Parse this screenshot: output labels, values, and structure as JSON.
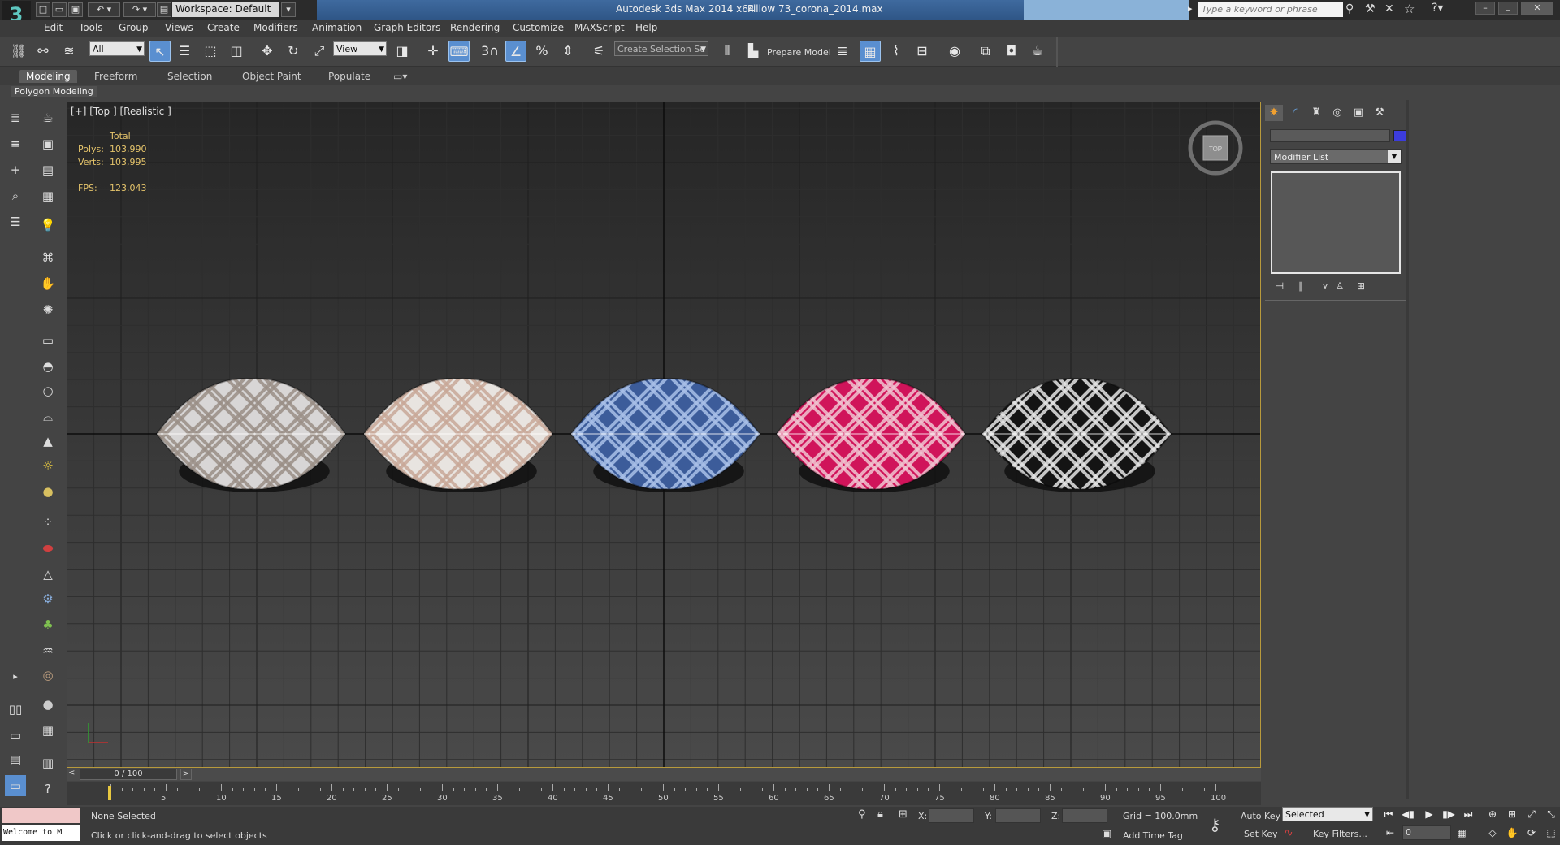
{
  "titlebar": {
    "app_title": "Autodesk 3ds Max  2014 x64",
    "file_name": "Pillow 73_corona_2014.max",
    "workspace_label": "Workspace: Default",
    "search_placeholder": "Type a keyword or phrase"
  },
  "menu": [
    "Edit",
    "Tools",
    "Group",
    "Views",
    "Create",
    "Modifiers",
    "Animation",
    "Graph Editors",
    "Rendering",
    "Customize",
    "MAXScript",
    "Help"
  ],
  "toolbar": {
    "selection_filter": "All",
    "ref_coord": "View",
    "named_selection": "Create Selection Se",
    "prepare_model": "Prepare Model",
    "snap_label": "3",
    "percent_label": "%"
  },
  "ribbon": {
    "tabs": [
      "Modeling",
      "Freeform",
      "Selection",
      "Object Paint",
      "Populate"
    ],
    "panel": "Polygon Modeling"
  },
  "viewport": {
    "label": "[+] [Top ] [Realistic ]",
    "stats": {
      "total_label": "Total",
      "polys_label": "Polys:",
      "polys_value": "103,990",
      "verts_label": "Verts:",
      "verts_value": "103,995",
      "fps_label": "FPS:",
      "fps_value": "123.043"
    },
    "viewcube_label": "TOP",
    "pillows": [
      {
        "color": "#d8d6d6",
        "stripe": "#9a8f87"
      },
      {
        "color": "#e8e4e0",
        "stripe": "#c8a898"
      },
      {
        "color": "#3c5c9a",
        "stripe": "#a8c0e8"
      },
      {
        "color": "#d0145a",
        "stripe": "#f0c4d0"
      },
      {
        "color": "#141414",
        "stripe": "#e4e4e4"
      }
    ]
  },
  "command_panel": {
    "modifier_list": "Modifier List"
  },
  "timeline": {
    "slider": "0 / 100",
    "ticks": [
      "0",
      "5",
      "10",
      "15",
      "20",
      "25",
      "30",
      "35",
      "40",
      "45",
      "50",
      "55",
      "60",
      "65",
      "70",
      "75",
      "80",
      "85",
      "90",
      "95",
      "100"
    ]
  },
  "status": {
    "welcome": "Welcome to M",
    "selection": "None Selected",
    "prompt": "Click or click-and-drag to select objects",
    "x_label": "X:",
    "y_label": "Y:",
    "z_label": "Z:",
    "grid": "Grid = 100.0mm",
    "add_time_tag": "Add Time Tag",
    "auto_key": "Auto Key",
    "set_key": "Set Key",
    "key_filters": "Key Filters...",
    "key_mode": "Selected",
    "frame": "0"
  }
}
